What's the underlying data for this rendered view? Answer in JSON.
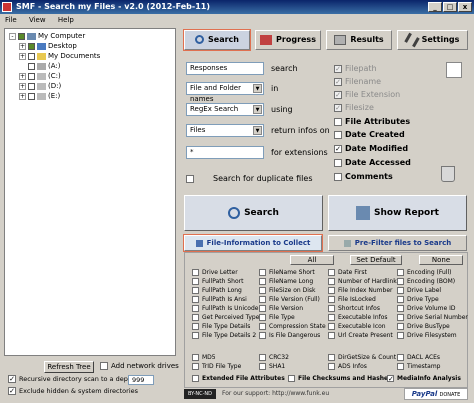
{
  "window": {
    "title": "SMF - Search my Files - v2.0 (2012-Feb-11)"
  },
  "menu": [
    "File",
    "View",
    "Help"
  ],
  "tree": [
    {
      "label": "My Computer",
      "level": 0
    },
    {
      "label": "Desktop",
      "level": 1
    },
    {
      "label": "My Documents",
      "level": 1
    },
    {
      "label": "(A:)",
      "level": 1
    },
    {
      "label": "(C:)",
      "level": 1
    },
    {
      "label": "(D:)",
      "level": 1
    },
    {
      "label": "(E:)",
      "level": 1
    }
  ],
  "bottom_left": {
    "refresh_tree": "Refresh Tree",
    "add_network_drives": "Add network drives",
    "recursive_scan": "Recursive directory scan to a depth of",
    "depth_value": "999",
    "exclude_hidden": "Exclude hidden & system directories"
  },
  "tabs": [
    "Search",
    "Progress",
    "Results",
    "Settings"
  ],
  "search_form": {
    "row1_value": "Responses",
    "row1_label": "search",
    "row2_value": "File and Folder names",
    "row2_label": "in",
    "row3_value": "RegEx Search",
    "row3_label": "using",
    "row4_value": "Files",
    "row4_label": "return infos on",
    "row5_value": "*",
    "row5_label": "for extensions",
    "duplicates_label": "Search for duplicate files"
  },
  "property_checks": [
    {
      "label": "Filepath",
      "checked": true,
      "disabled": true
    },
    {
      "label": "Filename",
      "checked": true,
      "disabled": true
    },
    {
      "label": "File Extension",
      "checked": true,
      "disabled": true
    },
    {
      "label": "Filesize",
      "checked": true,
      "disabled": true
    },
    {
      "label": "File Attributes",
      "checked": false,
      "disabled": false
    },
    {
      "label": "Date Created",
      "checked": false,
      "disabled": false
    },
    {
      "label": "Date Modified",
      "checked": true,
      "disabled": false
    },
    {
      "label": "Date Accessed",
      "checked": false,
      "disabled": false
    },
    {
      "label": "Comments",
      "checked": false,
      "disabled": false
    }
  ],
  "actions": {
    "search": "Search",
    "show_report": "Show Report"
  },
  "subtabs": [
    "File-Information to Collect",
    "Pre-Filter files to Search"
  ],
  "mini_buttons": [
    "All",
    "Set Default",
    "None"
  ],
  "attributes": [
    [
      "Drive Letter",
      "FullPath Short",
      "FullPath Long",
      "FullPath Is Ansi",
      "FullPath Is Unicode",
      "Get Perceived Type",
      "File Type Details",
      "File Type Details 2",
      "MD5",
      "TrID File Type"
    ],
    [
      "FileName Short",
      "FileName Long",
      "FileSize on Disk",
      "File Version (Full)",
      "File Version",
      "File Type",
      "Compression State",
      "Is File Dangerous",
      "CRC32",
      "SHA1"
    ],
    [
      "Date First",
      "Number of Hardlinks",
      "File Index Number",
      "File IsLocked",
      "Shortcut Infos",
      "Executable Infos",
      "Executable Icon",
      "Url Create Present",
      "DirGetSize & Count",
      "ADS Infos"
    ],
    [
      "Encoding (Full)",
      "Encoding (BOM)",
      "Drive Label",
      "Drive Type",
      "Drive Volume ID",
      "Drive Serial Number",
      "Drive BusType",
      "Drive Filesystem",
      "DACL ACEs",
      "Timestamp"
    ]
  ],
  "attribute_footer": [
    "Extended File Attributes",
    "File Checksums and Hashes",
    "MediaInfo Analysis"
  ],
  "footer": {
    "license": "BY-NC-ND",
    "url": "For our support: http://www.funk.eu",
    "paypal": "PayPal",
    "donate": "DONATE"
  }
}
